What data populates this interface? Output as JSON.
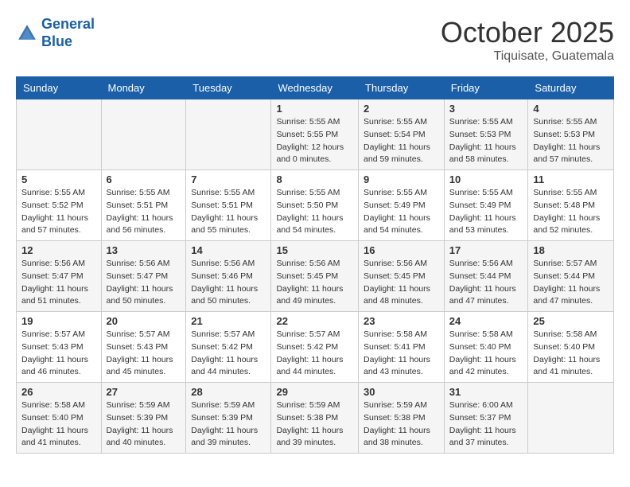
{
  "logo": {
    "text_general": "General",
    "text_blue": "Blue"
  },
  "title": "October 2025",
  "location": "Tiquisate, Guatemala",
  "days_of_week": [
    "Sunday",
    "Monday",
    "Tuesday",
    "Wednesday",
    "Thursday",
    "Friday",
    "Saturday"
  ],
  "weeks": [
    [
      {
        "day": "",
        "sunrise": "",
        "sunset": "",
        "daylight": ""
      },
      {
        "day": "",
        "sunrise": "",
        "sunset": "",
        "daylight": ""
      },
      {
        "day": "",
        "sunrise": "",
        "sunset": "",
        "daylight": ""
      },
      {
        "day": "1",
        "sunrise": "Sunrise: 5:55 AM",
        "sunset": "Sunset: 5:55 PM",
        "daylight": "Daylight: 12 hours and 0 minutes."
      },
      {
        "day": "2",
        "sunrise": "Sunrise: 5:55 AM",
        "sunset": "Sunset: 5:54 PM",
        "daylight": "Daylight: 11 hours and 59 minutes."
      },
      {
        "day": "3",
        "sunrise": "Sunrise: 5:55 AM",
        "sunset": "Sunset: 5:53 PM",
        "daylight": "Daylight: 11 hours and 58 minutes."
      },
      {
        "day": "4",
        "sunrise": "Sunrise: 5:55 AM",
        "sunset": "Sunset: 5:53 PM",
        "daylight": "Daylight: 11 hours and 57 minutes."
      }
    ],
    [
      {
        "day": "5",
        "sunrise": "Sunrise: 5:55 AM",
        "sunset": "Sunset: 5:52 PM",
        "daylight": "Daylight: 11 hours and 57 minutes."
      },
      {
        "day": "6",
        "sunrise": "Sunrise: 5:55 AM",
        "sunset": "Sunset: 5:51 PM",
        "daylight": "Daylight: 11 hours and 56 minutes."
      },
      {
        "day": "7",
        "sunrise": "Sunrise: 5:55 AM",
        "sunset": "Sunset: 5:51 PM",
        "daylight": "Daylight: 11 hours and 55 minutes."
      },
      {
        "day": "8",
        "sunrise": "Sunrise: 5:55 AM",
        "sunset": "Sunset: 5:50 PM",
        "daylight": "Daylight: 11 hours and 54 minutes."
      },
      {
        "day": "9",
        "sunrise": "Sunrise: 5:55 AM",
        "sunset": "Sunset: 5:49 PM",
        "daylight": "Daylight: 11 hours and 54 minutes."
      },
      {
        "day": "10",
        "sunrise": "Sunrise: 5:55 AM",
        "sunset": "Sunset: 5:49 PM",
        "daylight": "Daylight: 11 hours and 53 minutes."
      },
      {
        "day": "11",
        "sunrise": "Sunrise: 5:55 AM",
        "sunset": "Sunset: 5:48 PM",
        "daylight": "Daylight: 11 hours and 52 minutes."
      }
    ],
    [
      {
        "day": "12",
        "sunrise": "Sunrise: 5:56 AM",
        "sunset": "Sunset: 5:47 PM",
        "daylight": "Daylight: 11 hours and 51 minutes."
      },
      {
        "day": "13",
        "sunrise": "Sunrise: 5:56 AM",
        "sunset": "Sunset: 5:47 PM",
        "daylight": "Daylight: 11 hours and 50 minutes."
      },
      {
        "day": "14",
        "sunrise": "Sunrise: 5:56 AM",
        "sunset": "Sunset: 5:46 PM",
        "daylight": "Daylight: 11 hours and 50 minutes."
      },
      {
        "day": "15",
        "sunrise": "Sunrise: 5:56 AM",
        "sunset": "Sunset: 5:45 PM",
        "daylight": "Daylight: 11 hours and 49 minutes."
      },
      {
        "day": "16",
        "sunrise": "Sunrise: 5:56 AM",
        "sunset": "Sunset: 5:45 PM",
        "daylight": "Daylight: 11 hours and 48 minutes."
      },
      {
        "day": "17",
        "sunrise": "Sunrise: 5:56 AM",
        "sunset": "Sunset: 5:44 PM",
        "daylight": "Daylight: 11 hours and 47 minutes."
      },
      {
        "day": "18",
        "sunrise": "Sunrise: 5:57 AM",
        "sunset": "Sunset: 5:44 PM",
        "daylight": "Daylight: 11 hours and 47 minutes."
      }
    ],
    [
      {
        "day": "19",
        "sunrise": "Sunrise: 5:57 AM",
        "sunset": "Sunset: 5:43 PM",
        "daylight": "Daylight: 11 hours and 46 minutes."
      },
      {
        "day": "20",
        "sunrise": "Sunrise: 5:57 AM",
        "sunset": "Sunset: 5:43 PM",
        "daylight": "Daylight: 11 hours and 45 minutes."
      },
      {
        "day": "21",
        "sunrise": "Sunrise: 5:57 AM",
        "sunset": "Sunset: 5:42 PM",
        "daylight": "Daylight: 11 hours and 44 minutes."
      },
      {
        "day": "22",
        "sunrise": "Sunrise: 5:57 AM",
        "sunset": "Sunset: 5:42 PM",
        "daylight": "Daylight: 11 hours and 44 minutes."
      },
      {
        "day": "23",
        "sunrise": "Sunrise: 5:58 AM",
        "sunset": "Sunset: 5:41 PM",
        "daylight": "Daylight: 11 hours and 43 minutes."
      },
      {
        "day": "24",
        "sunrise": "Sunrise: 5:58 AM",
        "sunset": "Sunset: 5:40 PM",
        "daylight": "Daylight: 11 hours and 42 minutes."
      },
      {
        "day": "25",
        "sunrise": "Sunrise: 5:58 AM",
        "sunset": "Sunset: 5:40 PM",
        "daylight": "Daylight: 11 hours and 41 minutes."
      }
    ],
    [
      {
        "day": "26",
        "sunrise": "Sunrise: 5:58 AM",
        "sunset": "Sunset: 5:40 PM",
        "daylight": "Daylight: 11 hours and 41 minutes."
      },
      {
        "day": "27",
        "sunrise": "Sunrise: 5:59 AM",
        "sunset": "Sunset: 5:39 PM",
        "daylight": "Daylight: 11 hours and 40 minutes."
      },
      {
        "day": "28",
        "sunrise": "Sunrise: 5:59 AM",
        "sunset": "Sunset: 5:39 PM",
        "daylight": "Daylight: 11 hours and 39 minutes."
      },
      {
        "day": "29",
        "sunrise": "Sunrise: 5:59 AM",
        "sunset": "Sunset: 5:38 PM",
        "daylight": "Daylight: 11 hours and 39 minutes."
      },
      {
        "day": "30",
        "sunrise": "Sunrise: 5:59 AM",
        "sunset": "Sunset: 5:38 PM",
        "daylight": "Daylight: 11 hours and 38 minutes."
      },
      {
        "day": "31",
        "sunrise": "Sunrise: 6:00 AM",
        "sunset": "Sunset: 5:37 PM",
        "daylight": "Daylight: 11 hours and 37 minutes."
      },
      {
        "day": "",
        "sunrise": "",
        "sunset": "",
        "daylight": ""
      }
    ]
  ]
}
